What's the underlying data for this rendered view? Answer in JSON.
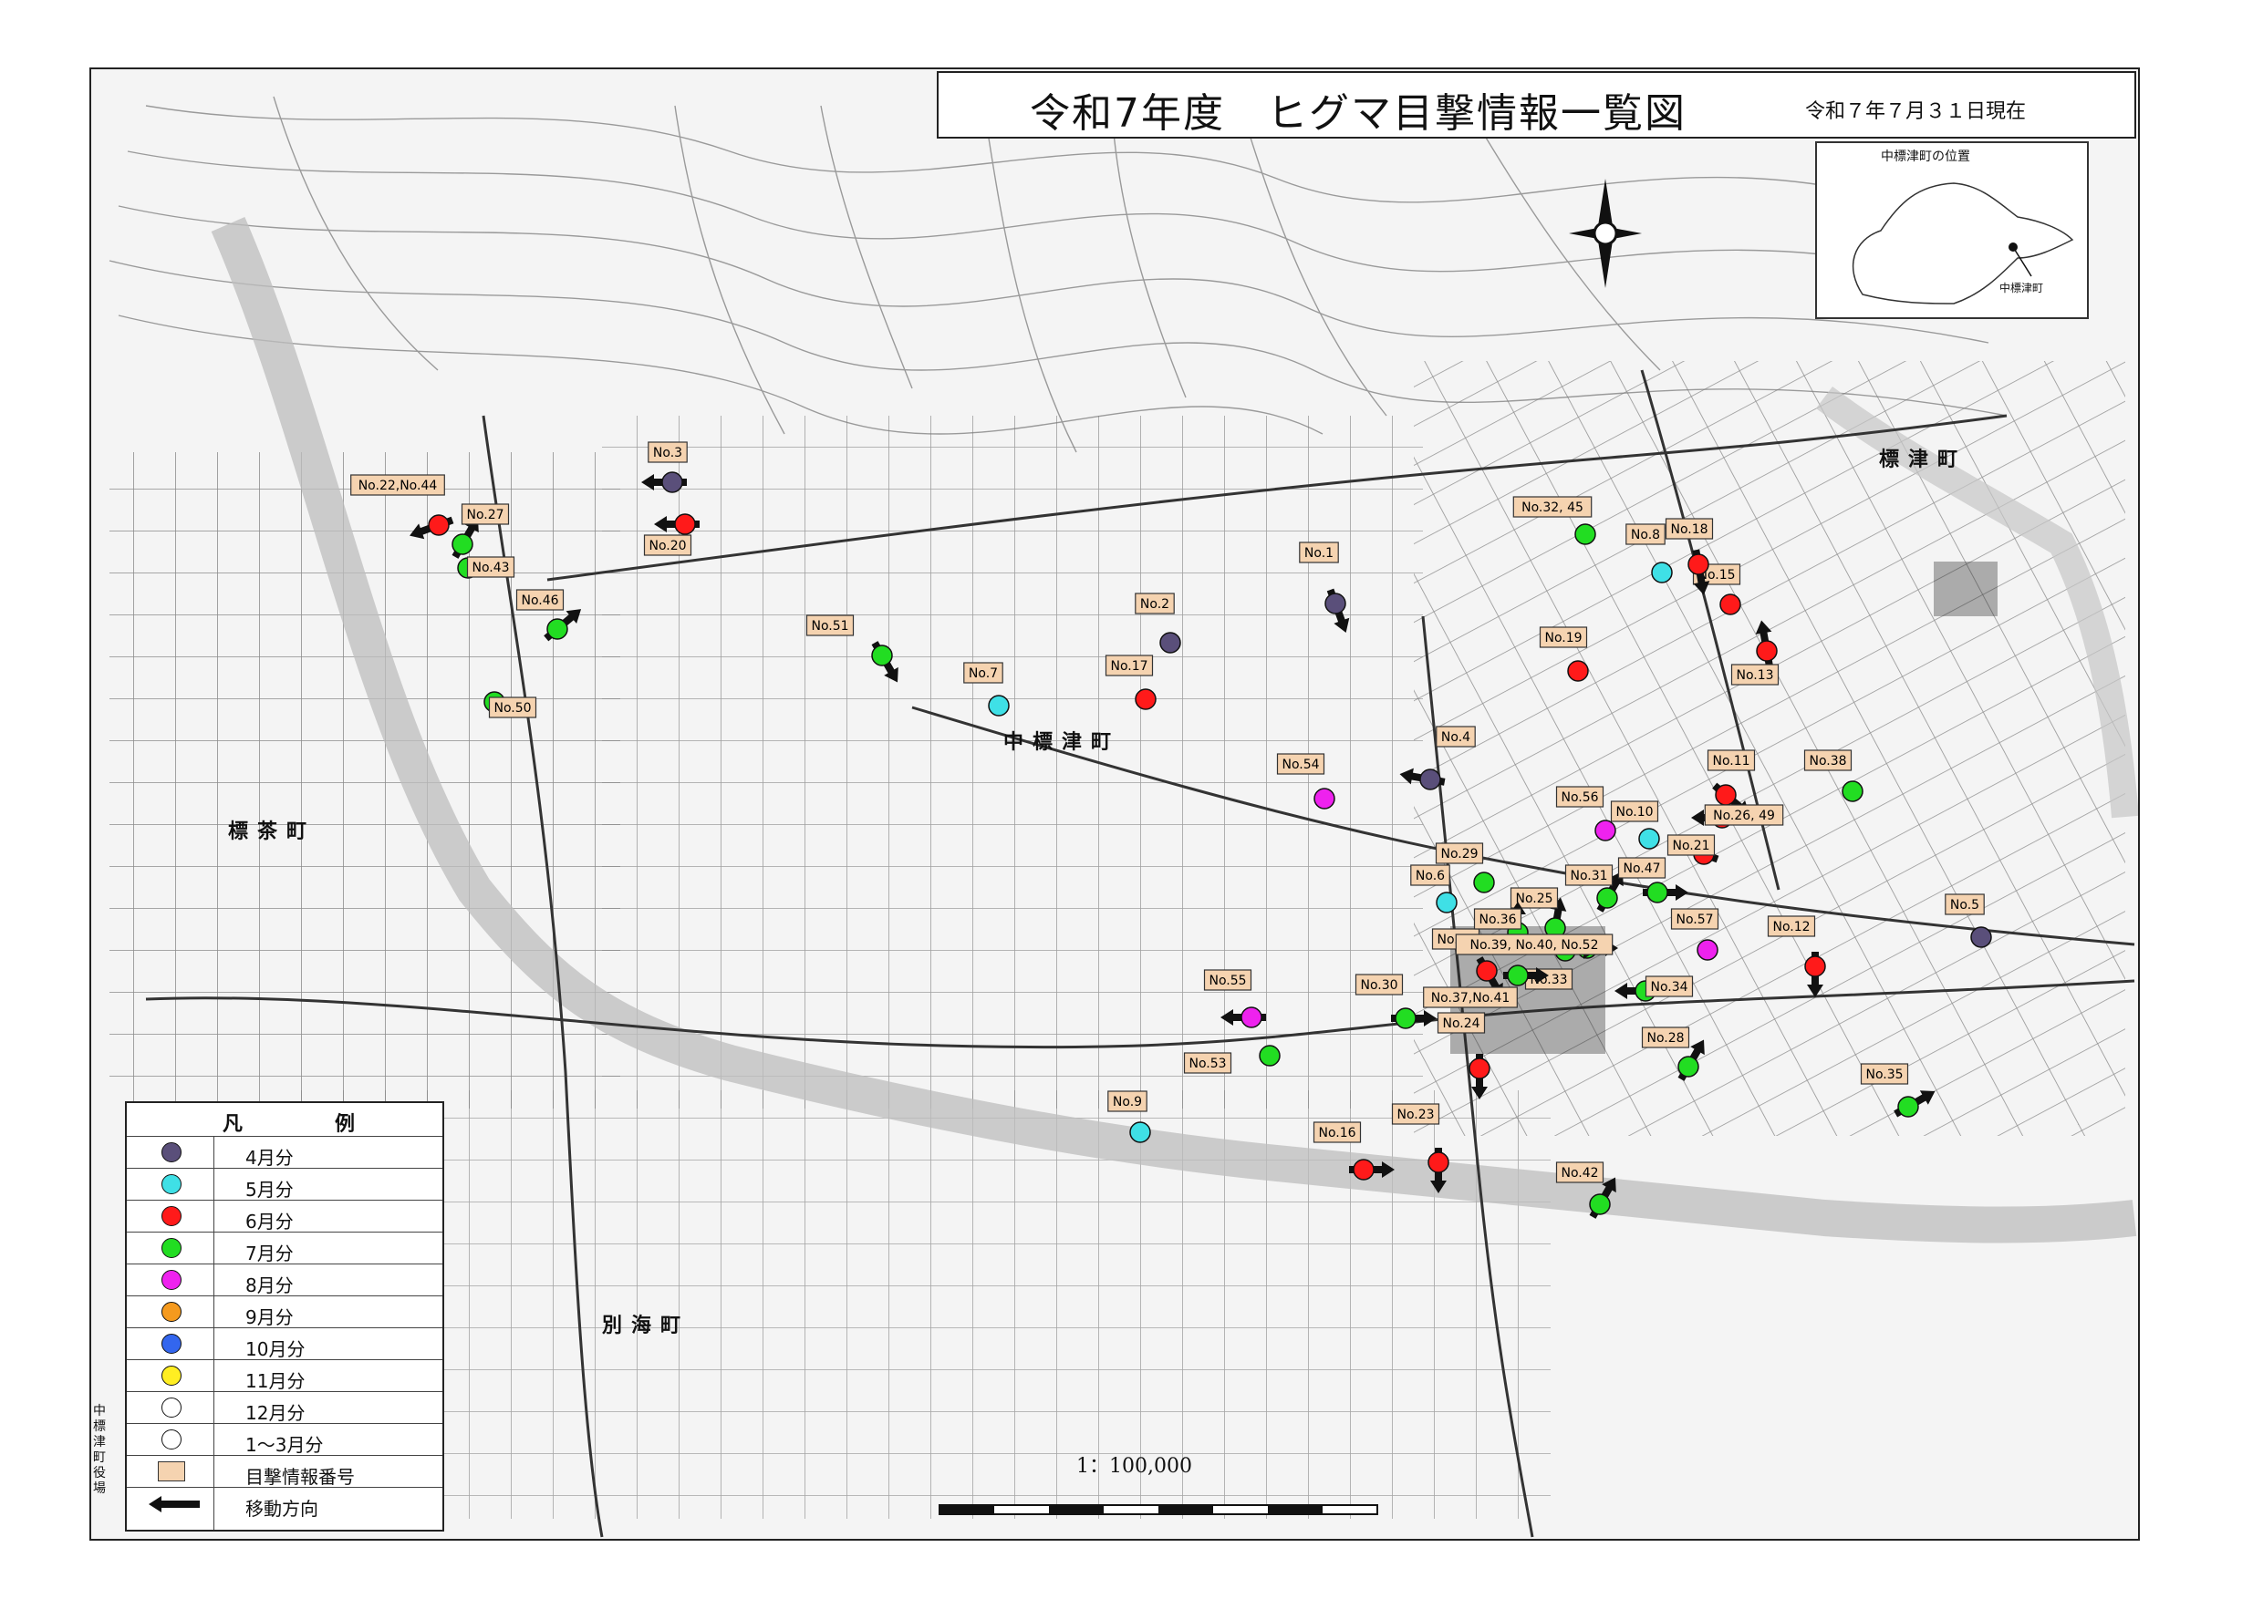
{
  "title": "令和7年度　ヒグマ目撃情報一覧図",
  "date": "令和７年７月３１日現在",
  "inset": {
    "title": "中標津町の位置",
    "town_label": "中標津町"
  },
  "scale_label": "1：100,000",
  "side_label": "中標津町役場",
  "place_names": [
    {
      "text": "中標津町"
    },
    {
      "text": "標茶町"
    },
    {
      "text": "別海町"
    },
    {
      "text": "標津町"
    }
  ],
  "legend": {
    "title_left": "凡",
    "title_right": "例",
    "items": [
      {
        "label": "4月分",
        "color": "#5a4f7a"
      },
      {
        "label": "5月分",
        "color": "#3fe0e6"
      },
      {
        "label": "6月分",
        "color": "#ff1a1a"
      },
      {
        "label": "7月分",
        "color": "#22dd22"
      },
      {
        "label": "8月分",
        "color": "#ee22ee"
      },
      {
        "label": "9月分",
        "color": "#f59a1e"
      },
      {
        "label": "10月分",
        "color": "#3366ee"
      },
      {
        "label": "11月分",
        "color": "#ffee22"
      },
      {
        "label": "12月分",
        "color": "#ffffff"
      },
      {
        "label": "1～3月分",
        "color": "#ffffff"
      }
    ],
    "number_label": "目撃情報番号",
    "move_label": "移動方向"
  },
  "sightings": [
    {
      "label": "No.1",
      "month": 4
    },
    {
      "label": "No.2",
      "month": 4
    },
    {
      "label": "No.3",
      "month": 4
    },
    {
      "label": "No.4",
      "month": 4
    },
    {
      "label": "No.5",
      "month": 4
    },
    {
      "label": "No.6",
      "month": 5
    },
    {
      "label": "No.7",
      "month": 5
    },
    {
      "label": "No.8",
      "month": 5
    },
    {
      "label": "No.9",
      "month": 5
    },
    {
      "label": "No.10",
      "month": 5
    },
    {
      "label": "No.11",
      "month": 6
    },
    {
      "label": "No.12",
      "month": 6
    },
    {
      "label": "No.13",
      "month": 6
    },
    {
      "label": "No.14",
      "month": 6
    },
    {
      "label": "No.15",
      "month": 6
    },
    {
      "label": "No.16",
      "month": 6
    },
    {
      "label": "No.17",
      "month": 6
    },
    {
      "label": "No.18",
      "month": 6
    },
    {
      "label": "No.19",
      "month": 6
    },
    {
      "label": "No.20",
      "month": 6
    },
    {
      "label": "No.21",
      "month": 6
    },
    {
      "label": "No.22,No.44",
      "month": 6
    },
    {
      "label": "No.23",
      "month": 6
    },
    {
      "label": "No.24",
      "month": 6
    },
    {
      "label": "No.25",
      "month": 7
    },
    {
      "label": "No.26, 49",
      "month": 6
    },
    {
      "label": "No.27",
      "month": 7
    },
    {
      "label": "No.28",
      "month": 7
    },
    {
      "label": "No.29",
      "month": 7
    },
    {
      "label": "No.30",
      "month": 7
    },
    {
      "label": "No.31",
      "month": 7
    },
    {
      "label": "No.32, 45",
      "month": 7
    },
    {
      "label": "No.33",
      "month": 7
    },
    {
      "label": "No.34",
      "month": 7
    },
    {
      "label": "No.35",
      "month": 7
    },
    {
      "label": "No.36",
      "month": 7
    },
    {
      "label": "No.37,No.41",
      "month": 7
    },
    {
      "label": "No.38",
      "month": 7
    },
    {
      "label": "No.39, No.40, No.52",
      "month": 7
    },
    {
      "label": "No.42",
      "month": 7
    },
    {
      "label": "No.43",
      "month": 7
    },
    {
      "label": "No.46",
      "month": 7
    },
    {
      "label": "No.47",
      "month": 7
    },
    {
      "label": "No.50",
      "month": 7
    },
    {
      "label": "No.51",
      "month": 7
    },
    {
      "label": "No.53",
      "month": 7
    },
    {
      "label": "No.54",
      "month": 8
    },
    {
      "label": "No.55",
      "month": 8
    },
    {
      "label": "No.56",
      "month": 8
    },
    {
      "label": "No.57",
      "month": 8
    }
  ]
}
